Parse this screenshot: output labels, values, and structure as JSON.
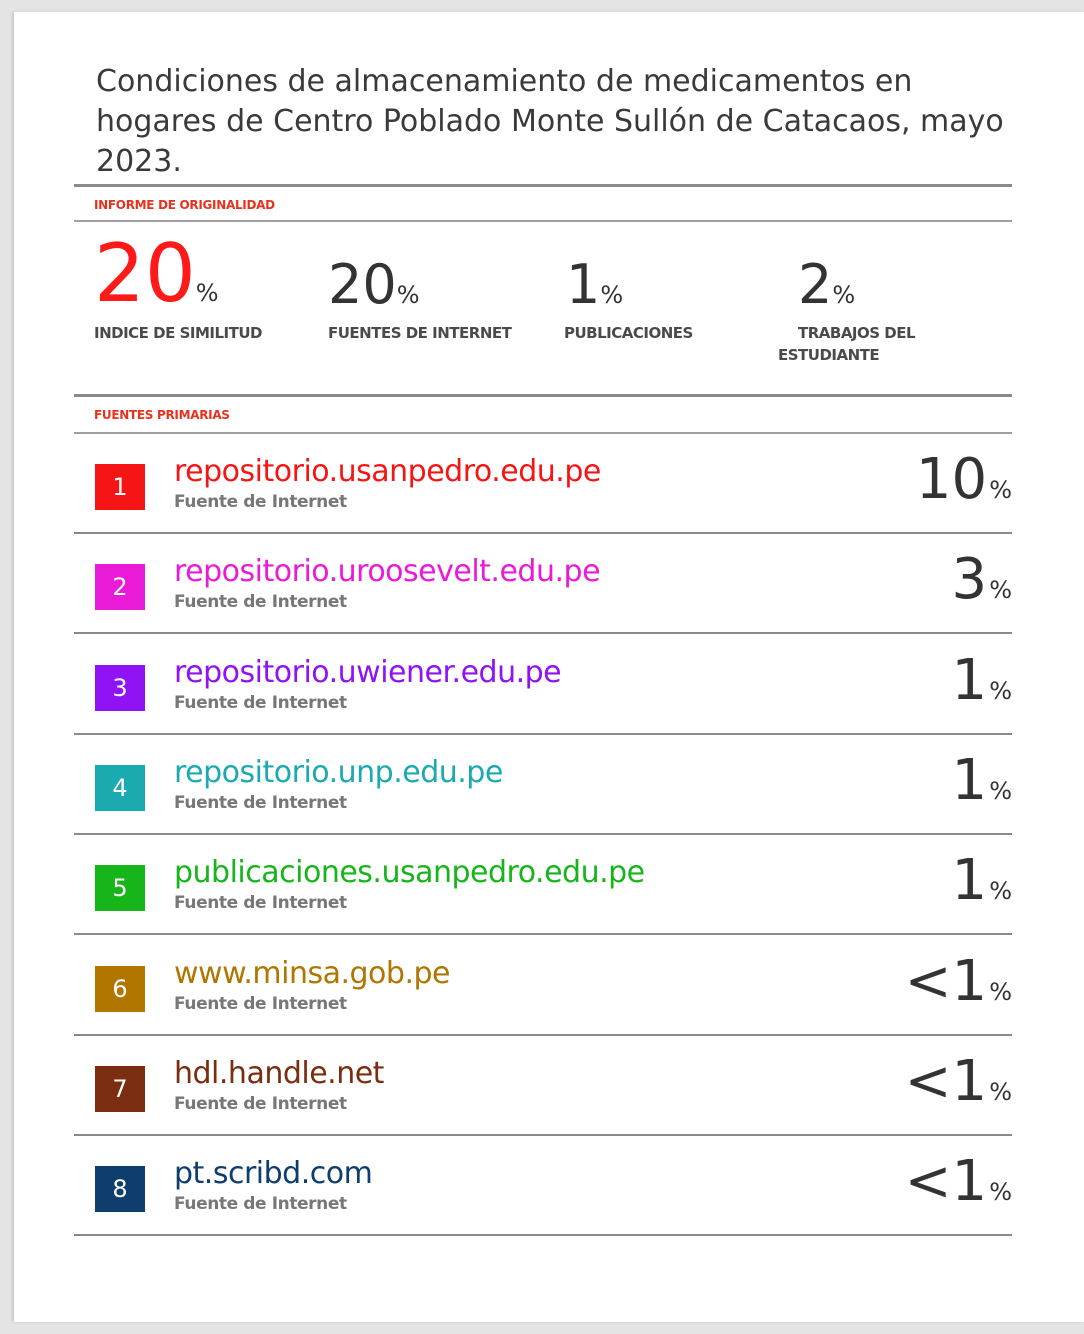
{
  "document": {
    "title": "Condiciones de almacenamiento de medicamentos en hogares de Centro Poblado Monte Sullón de Catacaos, mayo 2023."
  },
  "report": {
    "section_label": "INFORME DE ORIGINALIDAD",
    "stats": [
      {
        "value": "20",
        "unit": "%",
        "label": "INDICE DE SIMILITUD",
        "color": "#ff1a1a"
      },
      {
        "value": "20",
        "unit": "%",
        "label": "FUENTES DE INTERNET",
        "color": "#333333"
      },
      {
        "value": "1",
        "unit": "%",
        "label": "PUBLICACIONES",
        "color": "#333333"
      },
      {
        "value": "2",
        "unit": "%",
        "label_line1": "TRABAJOS DEL",
        "label_line2": "ESTUDIANTE",
        "color": "#333333"
      }
    ]
  },
  "sources": {
    "section_label": "FUENTES PRIMARIAS",
    "items": [
      {
        "number": "1",
        "source": "repositorio.usanpedro.edu.pe",
        "type": "Fuente de Internet",
        "value": "10",
        "unit": "%",
        "color": "#f51515"
      },
      {
        "number": "2",
        "source": "repositorio.uroosevelt.edu.pe",
        "type": "Fuente de Internet",
        "value": "3",
        "unit": "%",
        "color": "#ea1ad9"
      },
      {
        "number": "3",
        "source": "repositorio.uwiener.edu.pe",
        "type": "Fuente de Internet",
        "value": "1",
        "unit": "%",
        "color": "#8f13f5"
      },
      {
        "number": "4",
        "source": "repositorio.unp.edu.pe",
        "type": "Fuente de Internet",
        "value": "1",
        "unit": "%",
        "color": "#1aaab0"
      },
      {
        "number": "5",
        "source": "publicaciones.usanpedro.edu.pe",
        "type": "Fuente de Internet",
        "value": "1",
        "unit": "%",
        "color": "#16b61b"
      },
      {
        "number": "6",
        "source": "www.minsa.gob.pe",
        "type": "Fuente de Internet",
        "value": "<1",
        "unit": "%",
        "color": "#b07600"
      },
      {
        "number": "7",
        "source": "hdl.handle.net",
        "type": "Fuente de Internet",
        "value": "<1",
        "unit": "%",
        "color": "#7a2e0f"
      },
      {
        "number": "8",
        "source": "pt.scribd.com",
        "type": "Fuente de Internet",
        "value": "<1",
        "unit": "%",
        "color": "#0d3e6e"
      }
    ]
  }
}
